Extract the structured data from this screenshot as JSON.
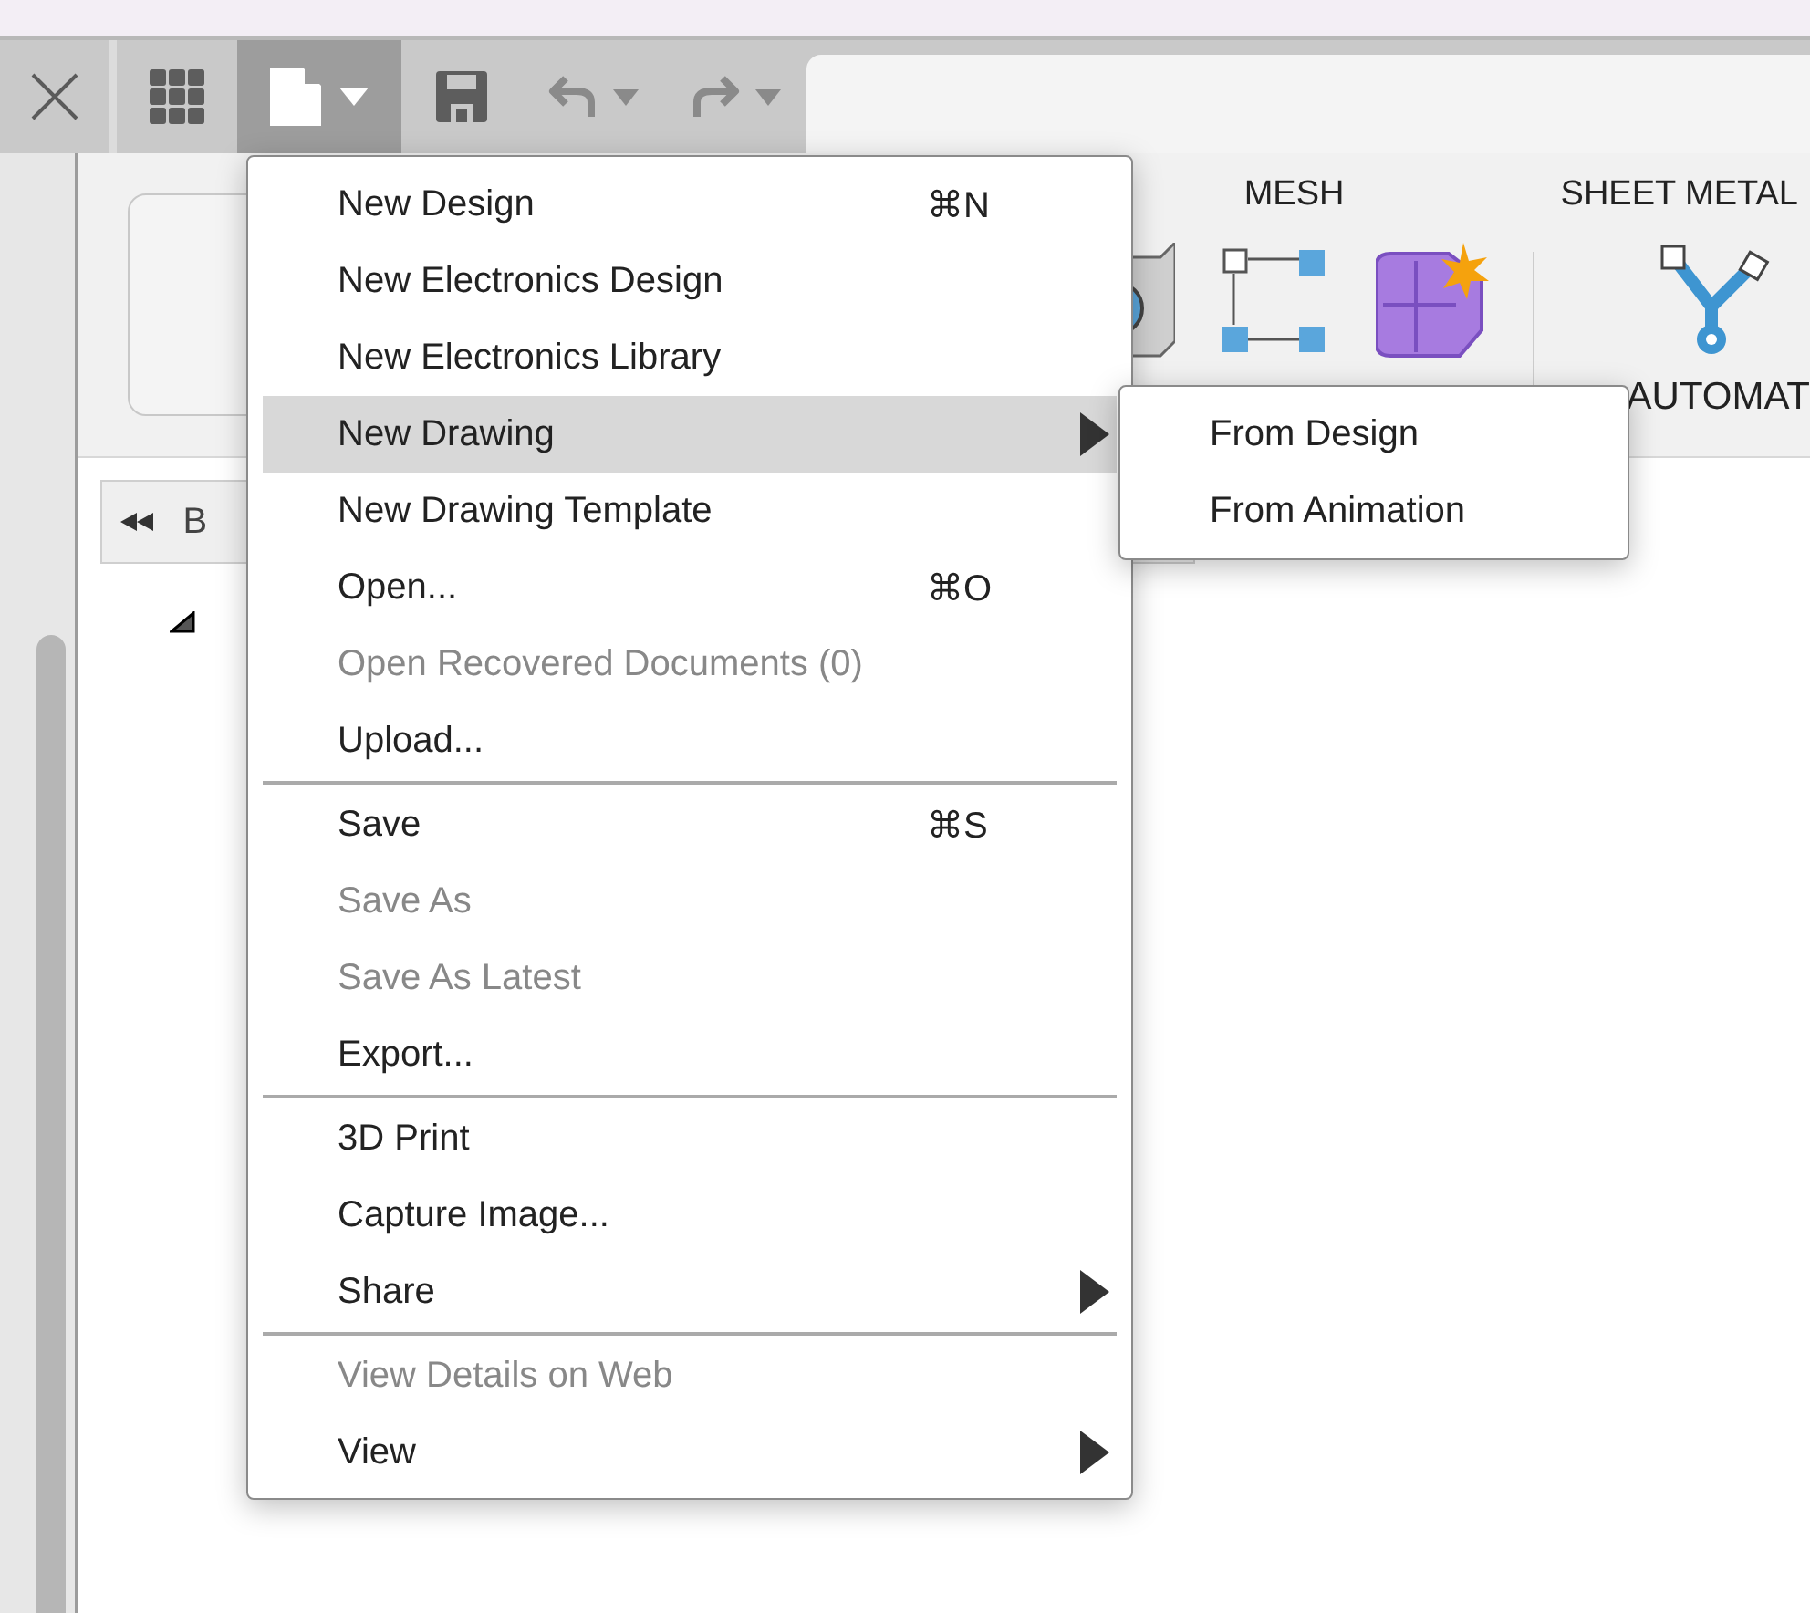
{
  "toolbar": {
    "file_button": {
      "selected": true
    }
  },
  "ribbon": {
    "tabs": [
      {
        "label": "MESH"
      },
      {
        "label": "SHEET METAL"
      }
    ],
    "group_labels": [
      {
        "label": "AUTOMAT"
      }
    ]
  },
  "browser": {
    "title": "B"
  },
  "file_menu": {
    "items": [
      {
        "kind": "item",
        "label": "New Design",
        "shortcut": "⌘N",
        "disabled": false,
        "selected": false,
        "submenu": false
      },
      {
        "kind": "item",
        "label": "New Electronics Design",
        "disabled": false,
        "selected": false,
        "submenu": false
      },
      {
        "kind": "item",
        "label": "New Electronics Library",
        "disabled": false,
        "selected": false,
        "submenu": false
      },
      {
        "kind": "item",
        "label": "New Drawing",
        "disabled": false,
        "selected": true,
        "submenu": true
      },
      {
        "kind": "item",
        "label": "New Drawing Template",
        "disabled": false,
        "selected": false,
        "submenu": false
      },
      {
        "kind": "item",
        "label": "Open...",
        "shortcut": "⌘O",
        "disabled": false,
        "selected": false,
        "submenu": false
      },
      {
        "kind": "item",
        "label": "Open Recovered Documents (0)",
        "disabled": true,
        "selected": false,
        "submenu": false
      },
      {
        "kind": "item",
        "label": "Upload...",
        "disabled": false,
        "selected": false,
        "submenu": false
      },
      {
        "kind": "separator"
      },
      {
        "kind": "item",
        "label": "Save",
        "shortcut": "⌘S",
        "disabled": false,
        "selected": false,
        "submenu": false
      },
      {
        "kind": "item",
        "label": "Save As",
        "disabled": true,
        "selected": false,
        "submenu": false
      },
      {
        "kind": "item",
        "label": "Save As Latest",
        "disabled": true,
        "selected": false,
        "submenu": false
      },
      {
        "kind": "item",
        "label": "Export...",
        "disabled": false,
        "selected": false,
        "submenu": false
      },
      {
        "kind": "separator"
      },
      {
        "kind": "item",
        "label": "3D Print",
        "disabled": false,
        "selected": false,
        "submenu": false
      },
      {
        "kind": "item",
        "label": "Capture Image...",
        "disabled": false,
        "selected": false,
        "submenu": false
      },
      {
        "kind": "item",
        "label": "Share",
        "disabled": false,
        "selected": false,
        "submenu": true
      },
      {
        "kind": "separator"
      },
      {
        "kind": "item",
        "label": "View Details on Web",
        "disabled": true,
        "selected": false,
        "submenu": false
      },
      {
        "kind": "item",
        "label": "View",
        "disabled": false,
        "selected": false,
        "submenu": true
      }
    ]
  },
  "submenu": {
    "items": [
      {
        "label": "From Design"
      },
      {
        "label": "From Animation"
      }
    ]
  }
}
